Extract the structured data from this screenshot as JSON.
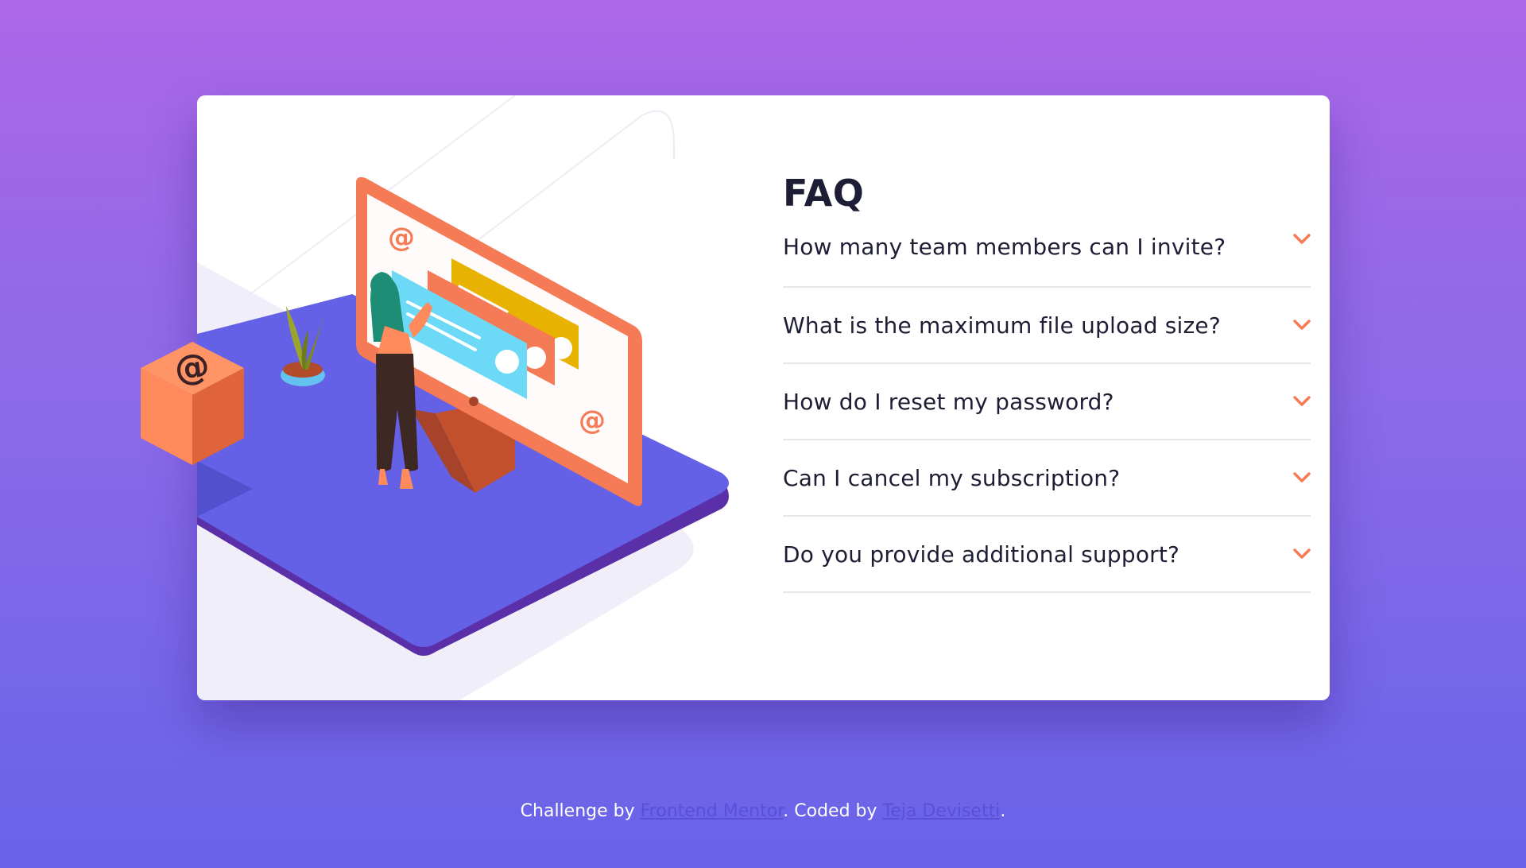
{
  "faq": {
    "title": "FAQ",
    "items": [
      {
        "question": "How many team members can I invite?"
      },
      {
        "question": "What is the maximum file upload size?"
      },
      {
        "question": "How do I reset my password?"
      },
      {
        "question": "Can I cancel my subscription?"
      },
      {
        "question": "Do you provide additional support?"
      }
    ]
  },
  "footer": {
    "prefix": "Challenge by ",
    "link1": "Frontend Mentor",
    "middle": ". Coded by ",
    "link2": "Teja Devisetti",
    "suffix": "."
  },
  "colors": {
    "background_top": "#ac67e8",
    "background_bottom": "#6863e8",
    "accent": "#f47b56",
    "text": "#1d1e35",
    "divider": "#e7e7e9",
    "link": "#5a50d8"
  },
  "icons": {
    "cube": "at-sign-box-icon",
    "chevron": "chevron-down-icon"
  }
}
